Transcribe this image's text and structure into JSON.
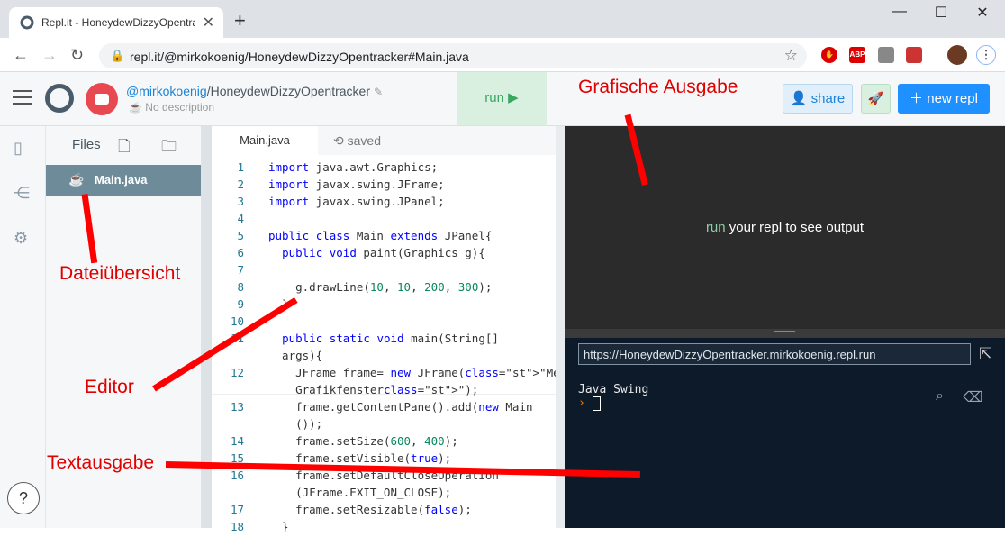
{
  "browser": {
    "tab_title": "Repl.it - HoneydewDizzyOpentrac",
    "tab_close": "✕",
    "new_tab": "+",
    "window_buttons": [
      "—",
      "☐",
      "✕"
    ],
    "url": "repl.it/@mirkokoenig/HoneydewDizzyOpentracker#Main.java",
    "extensions": [
      "ABP"
    ]
  },
  "repl": {
    "user": "@mirkokoenig",
    "name": "HoneydewDizzyOpentracker",
    "description": "No description",
    "run_label": "run ▶",
    "share_label": "share",
    "new_repl_label": "new repl"
  },
  "files_panel": {
    "title": "Files",
    "files": [
      {
        "name": "Main.java"
      }
    ]
  },
  "editor": {
    "tab": "Main.java",
    "status": "saved",
    "lines": [
      {
        "n": "1",
        "t": "import java.awt.Graphics;"
      },
      {
        "n": "2",
        "t": "import javax.swing.JFrame;"
      },
      {
        "n": "3",
        "t": "import javax.swing.JPanel;"
      },
      {
        "n": "4",
        "t": ""
      },
      {
        "n": "5",
        "t": "public class Main extends JPanel{"
      },
      {
        "n": "6",
        "t": "  public void paint(Graphics g){"
      },
      {
        "n": "7",
        "t": ""
      },
      {
        "n": "8",
        "t": "    g.drawLine(10, 10, 200, 300);"
      },
      {
        "n": "9",
        "t": "  }"
      },
      {
        "n": "10",
        "t": ""
      },
      {
        "n": "11",
        "t": "  public static void main(String[]"
      },
      {
        "n": "",
        "t": "  args){"
      },
      {
        "n": "12",
        "t": "    JFrame frame= new JFrame(\"Mein"
      },
      {
        "n": "",
        "t": "    Grafikfenster\");"
      },
      {
        "n": "13",
        "t": "    frame.getContentPane().add(new Main"
      },
      {
        "n": "",
        "t": "    ());"
      },
      {
        "n": "14",
        "t": "    frame.setSize(600, 400);"
      },
      {
        "n": "15",
        "t": "    frame.setVisible(true);"
      },
      {
        "n": "16",
        "t": "    frame.setDefaultCloseOperation"
      },
      {
        "n": "",
        "t": "    (JFrame.EXIT_ON_CLOSE);"
      },
      {
        "n": "17",
        "t": "    frame.setResizable(false);"
      },
      {
        "n": "18",
        "t": "  }"
      }
    ]
  },
  "output": {
    "run_word": "run",
    "placeholder_rest": " your repl to see output",
    "console_url": "https://HoneydewDizzyOpentracker.mirkokoenig.repl.run",
    "console_text": "Java Swing",
    "prompt": "›"
  },
  "annotations": {
    "grafische_ausgabe": "Grafische Ausgabe",
    "dateiuebersicht": "Dateiübersicht",
    "editor": "Editor",
    "textausgabe": "Textausgabe"
  },
  "colors": {
    "annotation_red": "#ff0000",
    "run_green": "#36a860",
    "new_repl_blue": "#1e90ff",
    "file_selected": "#6e8b99"
  }
}
